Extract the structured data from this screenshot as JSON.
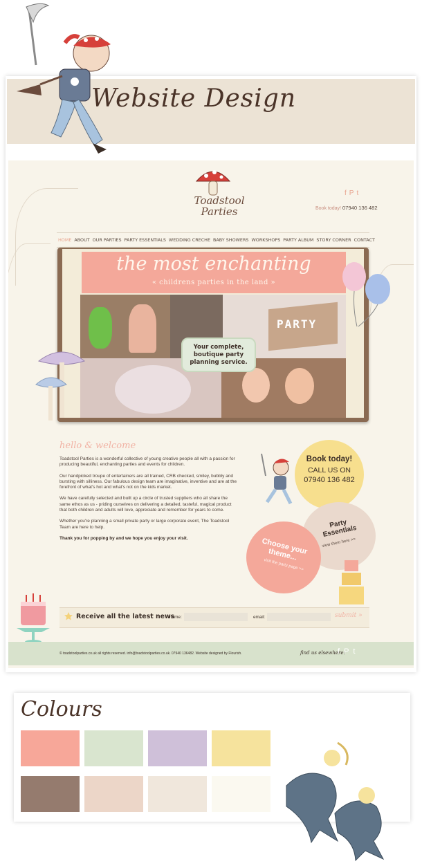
{
  "banner": {
    "title": "Website Design"
  },
  "logo": {
    "name_line1": "Toadstool",
    "name_line2": "Parties"
  },
  "header": {
    "booking_prompt": "Book today!",
    "booking_phone": "07940 136 482",
    "social_icons": [
      "facebook-icon",
      "pinterest-icon",
      "twitter-icon"
    ]
  },
  "nav": {
    "items": [
      {
        "label": "HOME",
        "active": true
      },
      {
        "label": "ABOUT"
      },
      {
        "label": "OUR PARTIES"
      },
      {
        "label": "PARTY ESSENTIALS"
      },
      {
        "label": "WEDDING CRECHE"
      },
      {
        "label": "BABY SHOWERS"
      },
      {
        "label": "WORKSHOPS"
      },
      {
        "label": "PARTY ALBUM"
      },
      {
        "label": "STORY CORNER"
      },
      {
        "label": "CONTACT"
      }
    ]
  },
  "hero": {
    "headline": "the most enchanting",
    "subheadline": "« childrens parties in the land »",
    "badge": "Your complete, boutique party planning service.",
    "party_box_label": "PARTY"
  },
  "intro": {
    "title": "hello & welcome",
    "paragraphs": [
      "Toadstool Parties is a wonderful collective of young creative people all with a passion for producing beautiful, enchanting parties and events for children.",
      "Our handpicked troupe of entertainers are all trained, CRB checked, smiley, bubbly and bursting with silliness. Our fabulous design team are imaginative, inventive and are at the forefront of what's hot and what's not on the kids market.",
      "We have carefully selected and built up a circle of trusted suppliers who all share the same ethos as us - priding ourselves on delivering a detailed, tasteful, magical product that both children and adults will love, appreciate and remember for years to come.",
      "Whether you're planning a small private party or large corporate event, The Toadstool Team are here to help."
    ],
    "closing": "Thank you for popping by and we hope you enjoy your visit."
  },
  "circles": {
    "book_title": "Book today!",
    "book_call": "CALL US ON",
    "book_phone": "07940 136 482",
    "essentials_title": "Party Essentials",
    "essentials_link": "view them here >>",
    "theme_title": "Choose your theme...",
    "theme_link": "visit the party page >>"
  },
  "newsletter": {
    "heading": "Receive all the latest news",
    "name_label": "name:",
    "email_label": "email:",
    "name_value": "",
    "email_value": "",
    "submit_label": "submit »"
  },
  "footer": {
    "copyright": "© toadstoolparties.co.uk all rights reserved. info@toadstoolparties.co.uk. 07940 136482. Website designed by Flourish.",
    "find_us": "find us elsewhere:",
    "social_icons": [
      "facebook-icon",
      "pinterest-icon",
      "twitter-icon"
    ]
  },
  "colours": {
    "title": "Colours",
    "swatches": [
      "#f7a799",
      "#d9e5cf",
      "#cfc0d9",
      "#f6e39d",
      "#957b6e",
      "#ecd6c8",
      "#f0e7dc",
      "#fbf9f0"
    ]
  }
}
